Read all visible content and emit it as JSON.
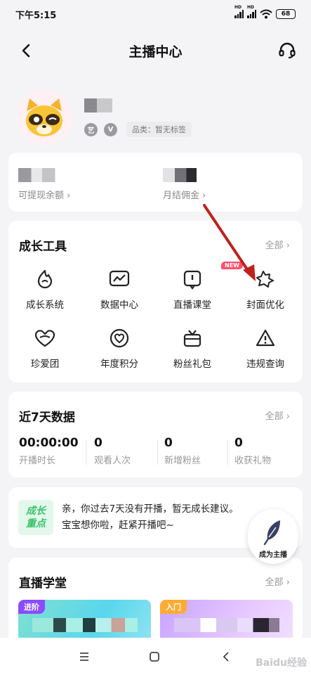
{
  "status_bar": {
    "time": "下午5:15",
    "hd1": "HD",
    "hd2": "HD",
    "battery": "68"
  },
  "header": {
    "title": "主播中心"
  },
  "profile": {
    "badge_a": "艺",
    "badge_b": "V",
    "category": "品类：暂无标签"
  },
  "earnings": {
    "withdrawable_label": "可提现余额 ›",
    "monthly_label": "月结佣金 ›"
  },
  "tools": {
    "title": "成长工具",
    "all_label": "全部 ›",
    "new_badge": "NEW",
    "items": [
      {
        "label": "成长系统",
        "icon": "flame-icon"
      },
      {
        "label": "数据中心",
        "icon": "chart-icon"
      },
      {
        "label": "直播课堂",
        "icon": "classroom-icon"
      },
      {
        "label": "封面优化",
        "icon": "cover-icon"
      },
      {
        "label": "珍爱团",
        "icon": "heart-shield-icon"
      },
      {
        "label": "年度积分",
        "icon": "heart-circle-icon"
      },
      {
        "label": "粉丝礼包",
        "icon": "gift-icon"
      },
      {
        "label": "违规查询",
        "icon": "warning-icon"
      }
    ]
  },
  "stats": {
    "title": "近7天数据",
    "all_label": "全部 ›",
    "items": [
      {
        "value": "00:00:00",
        "label": "开播时长"
      },
      {
        "value": "0",
        "label": "观看人次"
      },
      {
        "value": "0",
        "label": "新增粉丝"
      },
      {
        "value": "0",
        "label": "收获礼物"
      }
    ]
  },
  "advice": {
    "badge_line1": "成长",
    "badge_line2": "重点",
    "text": "亲，你过去7天没有开播，暂无成长建议。宝宝想你啦，赶紧开播吧~"
  },
  "fab": {
    "label": "成为主播"
  },
  "school": {
    "title": "直播学堂",
    "all_label": "全部 ›",
    "tag_left": "进阶",
    "tag_right": "入门"
  },
  "watermark": "Baidu经验",
  "colors": {
    "accent_red": "#c0201c",
    "new_badge": "#ff4f6e",
    "advice_green": "#37c26a"
  }
}
